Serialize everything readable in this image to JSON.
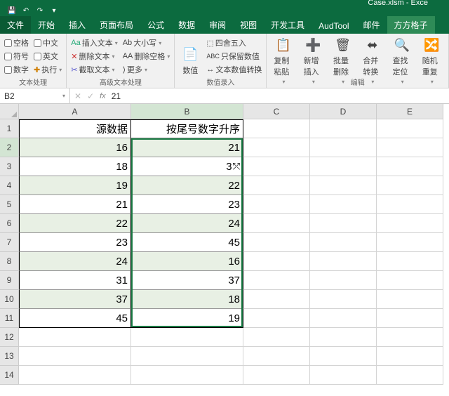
{
  "app": {
    "title": "Case.xlsm - Exce"
  },
  "tabs": {
    "file": "文件",
    "home": "开始",
    "insert": "插入",
    "layout": "页面布局",
    "formulas": "公式",
    "data": "数据",
    "review": "审阅",
    "view": "视图",
    "dev": "开发工具",
    "aud": "AudTool",
    "mail": "邮件",
    "ff": "方方格子"
  },
  "ribbon": {
    "g1": {
      "label": "文本处理",
      "space": "空格",
      "ch": "中文",
      "num": "数字",
      "sym": "符号",
      "en": "英文",
      "exec": "执行"
    },
    "g2": {
      "label": "高级文本处理",
      "ins": "插入文本",
      "del": "删除文本",
      "cut": "截取文本",
      "case": "大小写",
      "delsp": "删除空格",
      "more": "更多"
    },
    "g3": {
      "label": "数值录入",
      "val": "数值",
      "round": "四舍五入",
      "keep": "只保留数值",
      "conv": "文本数值转换"
    },
    "g4": {
      "label": "编辑",
      "copy": "复制粘贴",
      "newins": "新增插入",
      "batch": "批量删除",
      "merge": "合并转换",
      "find": "查找定位",
      "rand": "随机重复"
    }
  },
  "namebox": {
    "ref": "B2",
    "fx": "21"
  },
  "cols": [
    "A",
    "B",
    "C",
    "D",
    "E"
  ],
  "colw": {
    "A": 160,
    "B": 160,
    "C": 95,
    "D": 95,
    "E": 95
  },
  "headers": {
    "A": "源数据",
    "B": "按尾号数字升序"
  },
  "data": {
    "A": [
      16,
      18,
      19,
      21,
      22,
      23,
      24,
      31,
      37,
      45
    ],
    "B": [
      21,
      "3",
      22,
      23,
      24,
      45,
      16,
      37,
      18,
      19
    ]
  },
  "b3_suffix_icon": true,
  "rows_total": 14,
  "chart_data": {
    "type": "table",
    "columns": [
      "源数据",
      "按尾号数字升序"
    ],
    "rows": [
      [
        16,
        21
      ],
      [
        18,
        31
      ],
      [
        19,
        22
      ],
      [
        21,
        23
      ],
      [
        22,
        24
      ],
      [
        23,
        45
      ],
      [
        24,
        16
      ],
      [
        31,
        37
      ],
      [
        37,
        18
      ],
      [
        45,
        19
      ]
    ]
  }
}
